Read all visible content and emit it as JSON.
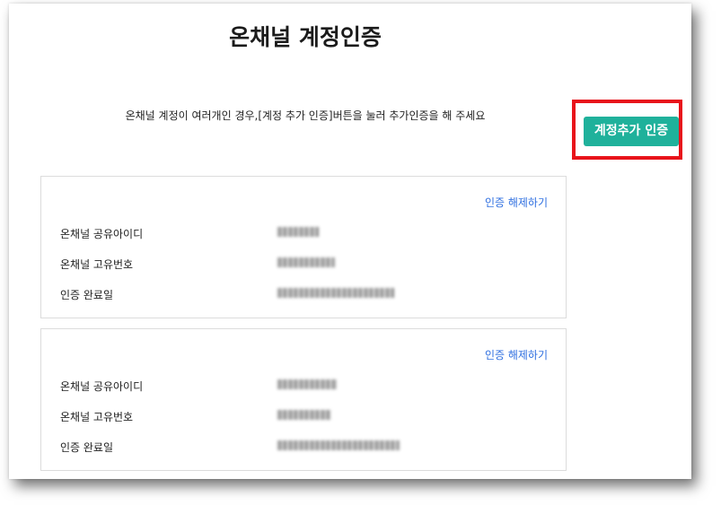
{
  "page": {
    "title": "온채널 계정인증",
    "instruction": "온채널 계정이 여러개인 경우,[계정 추가 인증]버튼을 눌러 추가인증을 해 주세요",
    "add_button_label": "계정추가 인증"
  },
  "accounts": [
    {
      "unlink_label": "인증 해제하기",
      "fields": [
        {
          "label": "온채널 공유아이디",
          "value": ""
        },
        {
          "label": "온채널 고유번호",
          "value": ""
        },
        {
          "label": "인증 완료일",
          "value": ""
        }
      ]
    },
    {
      "unlink_label": "인증 해제하기",
      "fields": [
        {
          "label": "온채널 공유아이디",
          "value": ""
        },
        {
          "label": "온채널 고유번호",
          "value": ""
        },
        {
          "label": "인증 완료일",
          "value": ""
        }
      ]
    }
  ],
  "colors": {
    "accent_button": "#1fb19b",
    "highlight_border": "#e8141b",
    "link": "#2f6fe0"
  }
}
